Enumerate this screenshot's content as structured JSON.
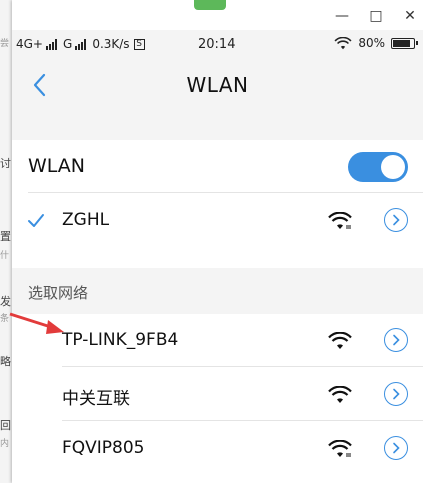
{
  "background": {
    "fragments": [
      "尝",
      "讨",
      "置",
      "什",
      "发",
      "条",
      "略",
      "回",
      "内"
    ]
  },
  "window": {
    "controls": {
      "minimize": "—",
      "maximize": "□",
      "close": "✕"
    }
  },
  "statusbar": {
    "network1": "4G+",
    "network2": "G",
    "speed": "0.3K/s",
    "speed_icon": "S",
    "time": "20:14",
    "battery_pct": "80%",
    "battery_level": 0.8
  },
  "navbar": {
    "title": "WLAN"
  },
  "wlan_toggle": {
    "label": "WLAN",
    "on": true
  },
  "connected": {
    "ssid": "ZGHL"
  },
  "available": {
    "header": "选取网络",
    "networks": [
      {
        "ssid": "TP-LINK_9FB4",
        "secured": false
      },
      {
        "ssid": "中关互联",
        "secured": false
      },
      {
        "ssid": "FQVIP805",
        "secured": true
      }
    ]
  },
  "colors": {
    "accent": "#3a8fe0",
    "annotation": "#e23b3b"
  }
}
